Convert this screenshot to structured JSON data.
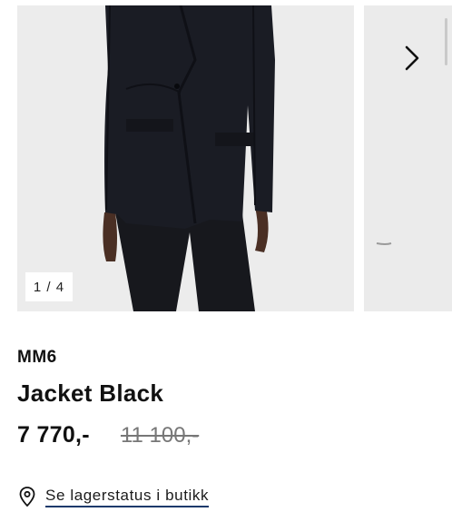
{
  "gallery": {
    "counter": "1 / 4",
    "next_icon": "chevron-right-icon"
  },
  "product": {
    "brand": "MM6",
    "title": "Jacket Black",
    "price_current": "7 770,-",
    "price_original": "11 100,-"
  },
  "store_stock": {
    "icon": "location-pin-icon",
    "label": "Se lagerstatus i butikk"
  },
  "colors": {
    "background": "#ffffff",
    "photo_backdrop": "#ededed",
    "link_underline": "#1b3a6b"
  }
}
